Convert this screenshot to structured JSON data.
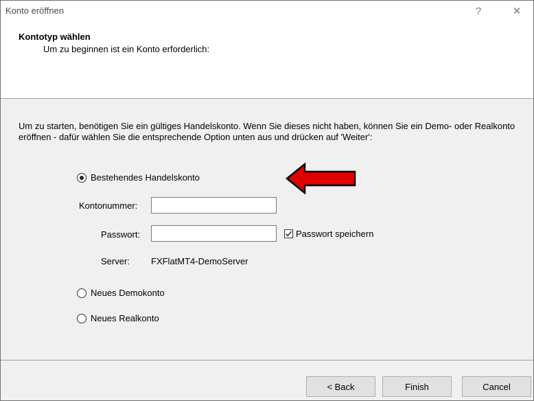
{
  "window": {
    "title": "Konto eröffnen",
    "help_glyph": "?",
    "close_glyph": "✕"
  },
  "header": {
    "title": "Kontotyp wählen",
    "subtitle": "Um zu beginnen ist ein Konto erforderlich:"
  },
  "intro_text": "Um zu starten, benötigen Sie ein gültiges Handelskonto. Wenn Sie dieses nicht haben, können Sie ein Demo- oder Realkonto eröffnen - dafür wählen Sie die entsprechende Option unten aus und drücken auf 'Weiter':",
  "options": {
    "existing": {
      "label": "Bestehendes Handelskonto",
      "checked": true
    },
    "demo": {
      "label": "Neues Demokonto",
      "checked": false
    },
    "real": {
      "label": "Neues Realkonto",
      "checked": false
    }
  },
  "fields": {
    "account_label": "Kontonummer:",
    "account_value": "",
    "password_label": "Passwort:",
    "password_value": "",
    "save_password_label": "Passwort speichern",
    "save_password_checked": true,
    "server_label": "Server:",
    "server_value": "FXFlatMT4-DemoServer"
  },
  "buttons": {
    "back": "< Back",
    "finish": "Finish",
    "cancel": "Cancel"
  },
  "colors": {
    "arrow_fill": "#e00000",
    "arrow_stroke": "#000000",
    "panel_bg": "#f0f0f0"
  }
}
